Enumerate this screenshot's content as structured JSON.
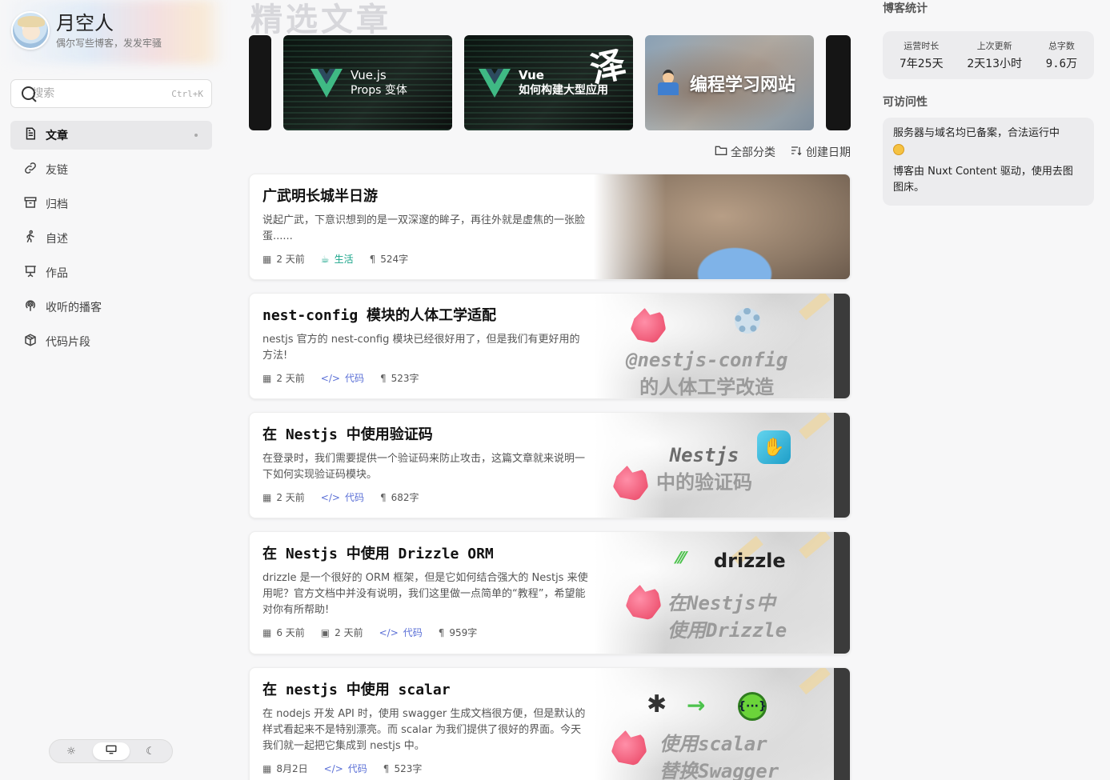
{
  "brand": {
    "title": "月空人",
    "subtitle": "偶尔写些博客，发发牢骚"
  },
  "search": {
    "placeholder": "搜索",
    "shortcut": "Ctrl+K"
  },
  "nav": [
    {
      "label": "文章",
      "icon": "article-icon",
      "active": true
    },
    {
      "label": "友链",
      "icon": "link-icon",
      "active": false
    },
    {
      "label": "归档",
      "icon": "archive-icon",
      "active": false
    },
    {
      "label": "自述",
      "icon": "walk-icon",
      "active": false
    },
    {
      "label": "作品",
      "icon": "presentation-icon",
      "active": false
    },
    {
      "label": "收听的播客",
      "icon": "podcast-icon",
      "active": false
    },
    {
      "label": "代码片段",
      "icon": "package-icon",
      "active": false
    }
  ],
  "theme_switch": {
    "options": [
      "light-icon",
      "system-icon",
      "dark-icon"
    ],
    "selected": "system"
  },
  "featured": {
    "title": "精选文章",
    "slides": [
      {
        "logo": "Vue",
        "line1": "Vue.js",
        "line2": "Props 变体"
      },
      {
        "logo": "Vue",
        "line1": "Vue",
        "line2": "如何构建大型应用",
        "badge": "泽"
      },
      {
        "line1": "编程学习网站"
      }
    ]
  },
  "filters": {
    "category": "全部分类",
    "sort": "创建日期"
  },
  "posts": [
    {
      "title": "广武明长城半日游",
      "desc": "说起广武，下意识想到的是一双深邃的眸子，再往外就是虚焦的一张脸蛋......",
      "created": "2 天前",
      "category": "生活",
      "words": "524字"
    },
    {
      "title": "nest-config 模块的人体工学适配",
      "desc": "nestjs 官方的 nest-config 模块已经很好用了，但是我们有更好用的方法!",
      "created": "2 天前",
      "category": "代码",
      "words": "523字",
      "cover_line1": "@nestjs-config",
      "cover_line2": "的人体工学改造"
    },
    {
      "title": "在 Nestjs 中使用验证码",
      "desc": "在登录时，我们需要提供一个验证码来防止攻击，这篇文章就来说明一下如何实现验证码模块。",
      "created": "2 天前",
      "category": "代码",
      "words": "682字",
      "cover_line1": "Nestjs",
      "cover_line2": "中的验证码"
    },
    {
      "title": "在 Nestjs 中使用 Drizzle ORM",
      "desc": "drizzle 是一个很好的 ORM 框架，但是它如何结合强大的 Nestjs 来使用呢？官方文档中并没有说明，我们这里做一点简单的“教程”，希望能对你有所帮助!",
      "created": "6 天前",
      "updated": "2 天前",
      "category": "代码",
      "words": "959字",
      "cover_brand": "drizzle",
      "cover_line1": "在Nestjs中",
      "cover_line2": "使用Drizzle"
    },
    {
      "title": "在 nestjs 中使用 scalar",
      "desc": "在 nodejs 开发 API 时，使用 swagger 生成文档很方便，但是默认的样式看起来不是特别漂亮。而 scalar 为我们提供了很好的界面。今天我们就一起把它集成到 nestjs 中。",
      "created": "8月2日",
      "category": "代码",
      "words": "523字",
      "cover_line1": "使用scalar",
      "cover_line2": "替换Swagger"
    }
  ],
  "stats": {
    "title": "博客统计",
    "items": [
      {
        "label": "运营时长",
        "value": "7年25天"
      },
      {
        "label": "上次更新",
        "value": "2天13小时"
      },
      {
        "label": "总字数",
        "value": "9.6万"
      }
    ]
  },
  "access": {
    "title": "可访问性",
    "line1": "服务器与域名均已备案，合法运行中",
    "line2": "博客由 Nuxt Content 驱动，使用去图图床。"
  }
}
